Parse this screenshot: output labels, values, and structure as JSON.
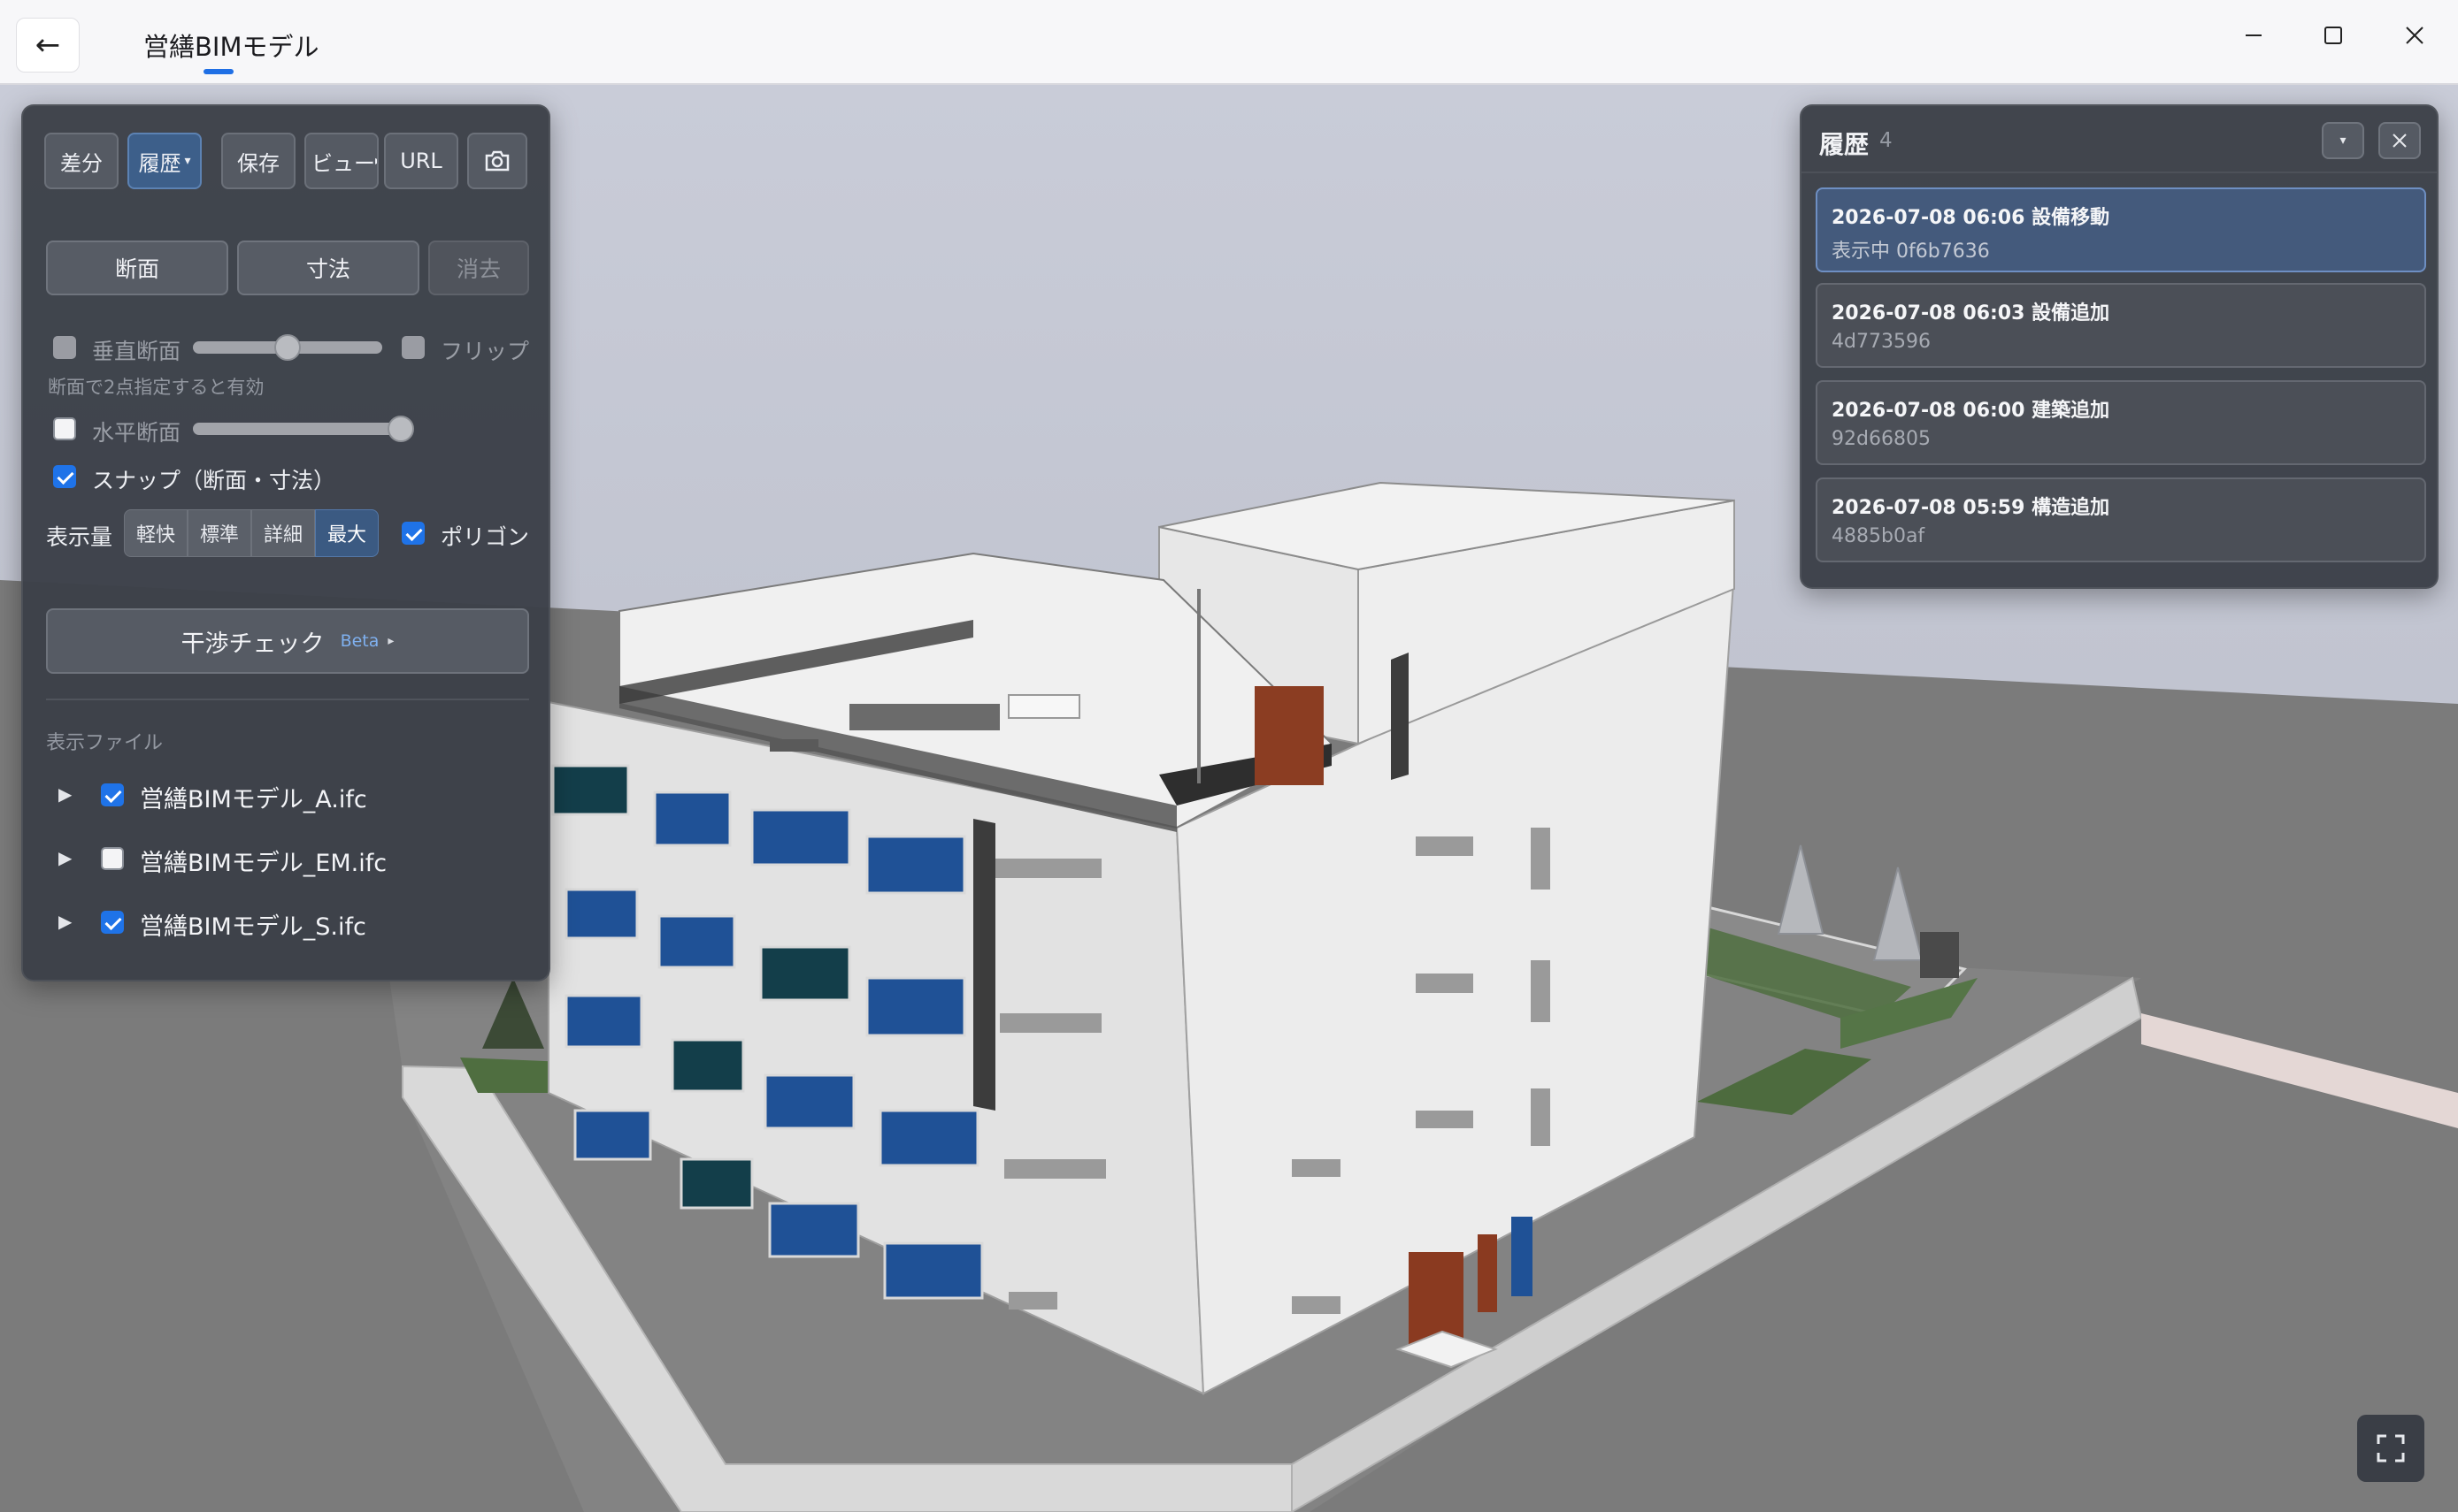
{
  "titlebar": {
    "back_glyph": "←",
    "title": "営繕BIMモデル",
    "minimize_icon": "minimize-icon",
    "maximize_icon": "maximize-icon",
    "close_icon": "close-icon"
  },
  "toolbar": {
    "diff_label": "差分",
    "history_label": "履歴",
    "save_label": "保存",
    "view_label": "ビュー",
    "url_label": "URL",
    "screenshot_icon": "camera-icon",
    "dropdown_glyph": "▾",
    "view_glyph": "▸"
  },
  "modes": {
    "section_label": "断面",
    "dimension_label": "寸法",
    "clear_label": "消去"
  },
  "section": {
    "vertical_label": "垂直断面",
    "flip_label": "フリップ",
    "hint": "断面で2点指定すると有効",
    "horizontal_label": "水平断面",
    "snap_label": "スナップ（断面・寸法）",
    "vertical_enabled": false,
    "horizontal_enabled": false,
    "snap_enabled": true,
    "vertical_slider_value": 0.5,
    "horizontal_slider_value": 1.0
  },
  "display": {
    "label": "表示量",
    "levels": [
      "軽快",
      "標準",
      "詳細",
      "最大"
    ],
    "selected": "最大",
    "polygon_label": "ポリゴン",
    "polygon_enabled": true
  },
  "clash": {
    "label": "干渉チェック",
    "badge": "Beta",
    "arrow": "▸"
  },
  "files": {
    "heading": "表示ファイル",
    "items": [
      {
        "name": "営繕BIMモデル_A.ifc",
        "visible": true
      },
      {
        "name": "営繕BIMモデル_EM.ifc",
        "visible": false
      },
      {
        "name": "営繕BIMモデル_S.ifc",
        "visible": true
      }
    ]
  },
  "history": {
    "title": "履歴",
    "count": "4",
    "collapse_glyph": "▾",
    "close_icon": "close-icon",
    "items": [
      {
        "title": "2026-07-08 06:06 設備移動",
        "sub": "表示中 0f6b7636",
        "selected": true
      },
      {
        "title": "2026-07-08 06:03 設備追加",
        "sub": "4d773596",
        "selected": false
      },
      {
        "title": "2026-07-08 06:00 建築追加",
        "sub": "92d66805",
        "selected": false
      },
      {
        "title": "2026-07-08 05:59 構造追加",
        "sub": "4885b0af",
        "selected": false
      }
    ]
  },
  "viewport": {
    "fullscreen_icon": "fullscreen-icon",
    "sky_color": "#c3c6d2",
    "ground_color": "#7a7a7a",
    "building_color": "#e6e6e6",
    "window_color": "#1f4f8f",
    "door_color": "#8a3a20"
  }
}
